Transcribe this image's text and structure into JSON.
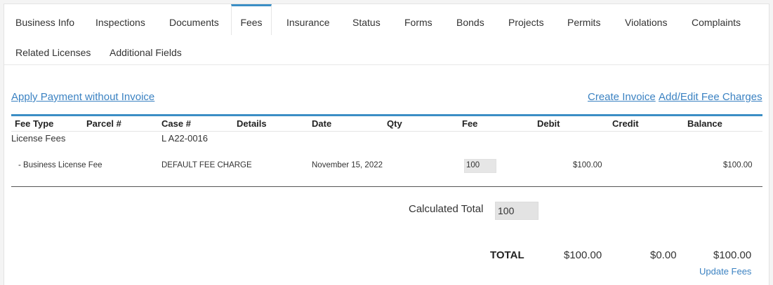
{
  "tabs": [
    {
      "label": "Business Info"
    },
    {
      "label": "Inspections"
    },
    {
      "label": "Documents"
    },
    {
      "label": "Fees"
    },
    {
      "label": "Insurance"
    },
    {
      "label": "Status"
    },
    {
      "label": "Forms"
    },
    {
      "label": "Bonds"
    },
    {
      "label": "Projects"
    },
    {
      "label": "Permits"
    },
    {
      "label": "Violations"
    },
    {
      "label": "Complaints"
    },
    {
      "label": "Related Licenses"
    },
    {
      "label": "Additional Fields"
    }
  ],
  "active_tab": "Fees",
  "actions": {
    "apply_payment": "Apply Payment without Invoice",
    "create_invoice": "Create Invoice",
    "add_edit_fee": "Add/Edit Fee Charges",
    "update_fees": "Update Fees"
  },
  "table": {
    "headers": [
      "Fee Type",
      "Parcel #",
      "Case #",
      "Details",
      "Date",
      "Qty",
      "Fee",
      "Debit",
      "Credit",
      "Balance"
    ],
    "group": {
      "fee_type": "License Fees",
      "case": "L A22-0016"
    },
    "row": {
      "fee_type": "- Business License Fee",
      "case": "DEFAULT FEE CHARGE",
      "date": "November 15, 2022",
      "fee": "100",
      "debit": "$100.00",
      "balance": "$100.00"
    }
  },
  "calculated_total": {
    "label": "Calculated Total",
    "value": "100"
  },
  "totals": {
    "label": "TOTAL",
    "debit": "$100.00",
    "credit": "$0.00",
    "balance": "$100.00"
  },
  "colors": {
    "accent": "#3b8ec5",
    "link": "#3b82c2"
  }
}
